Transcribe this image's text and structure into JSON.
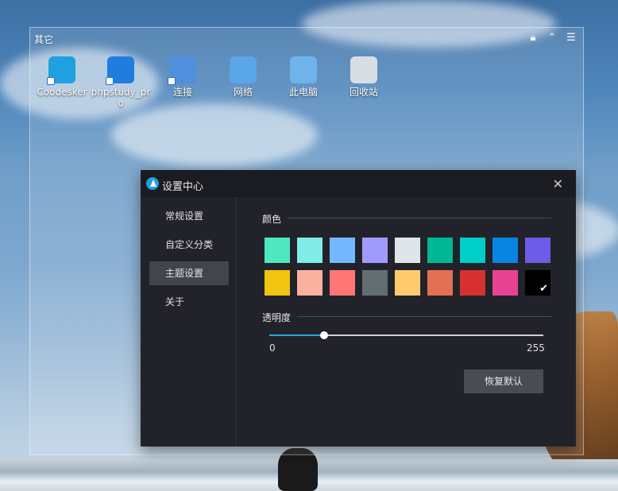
{
  "fence": {
    "title": "其它",
    "icons": [
      {
        "label": "Coodesker",
        "icon": "coodesker-icon",
        "color": "#1fa0e0",
        "shortcut": true
      },
      {
        "label": "phpstudy_pro",
        "icon": "phpstudy-icon",
        "color": "#1f7de0",
        "shortcut": true
      },
      {
        "label": "连接",
        "icon": "remote-connection-icon",
        "color": "#4f8fdd",
        "shortcut": true
      },
      {
        "label": "网络",
        "icon": "network-icon",
        "color": "#5aa6e8",
        "shortcut": false
      },
      {
        "label": "此电脑",
        "icon": "computer-icon",
        "color": "#6eb3ec",
        "shortcut": false
      },
      {
        "label": "回收站",
        "icon": "recycle-bin-icon",
        "color": "#d7dde3",
        "shortcut": false
      }
    ],
    "actions": [
      "lock-icon",
      "collapse-icon",
      "menu-icon"
    ]
  },
  "window": {
    "title": "设置中心",
    "sidebar": [
      "常规设置",
      "自定义分类",
      "主题设置",
      "关于"
    ],
    "active_index": 2,
    "color_section": "颜色",
    "colors": [
      "#4de8c0",
      "#81ebe7",
      "#74b9ff",
      "#a29bfe",
      "#dfe6e9",
      "#00b894",
      "#00cec9",
      "#0984e3",
      "#6c5ce7",
      "#f1c40f",
      "#fab1a0",
      "#ff7675",
      "#636e72",
      "#fdcb6e",
      "#e17055",
      "#d63031",
      "#e84393",
      "#000000"
    ],
    "selected_color_index": 17,
    "opacity_section": "透明度",
    "opacity_min": "0",
    "opacity_max": "255",
    "opacity_value": 0.2,
    "reset_label": "恢复默认",
    "accent": "#2aa6d9"
  }
}
